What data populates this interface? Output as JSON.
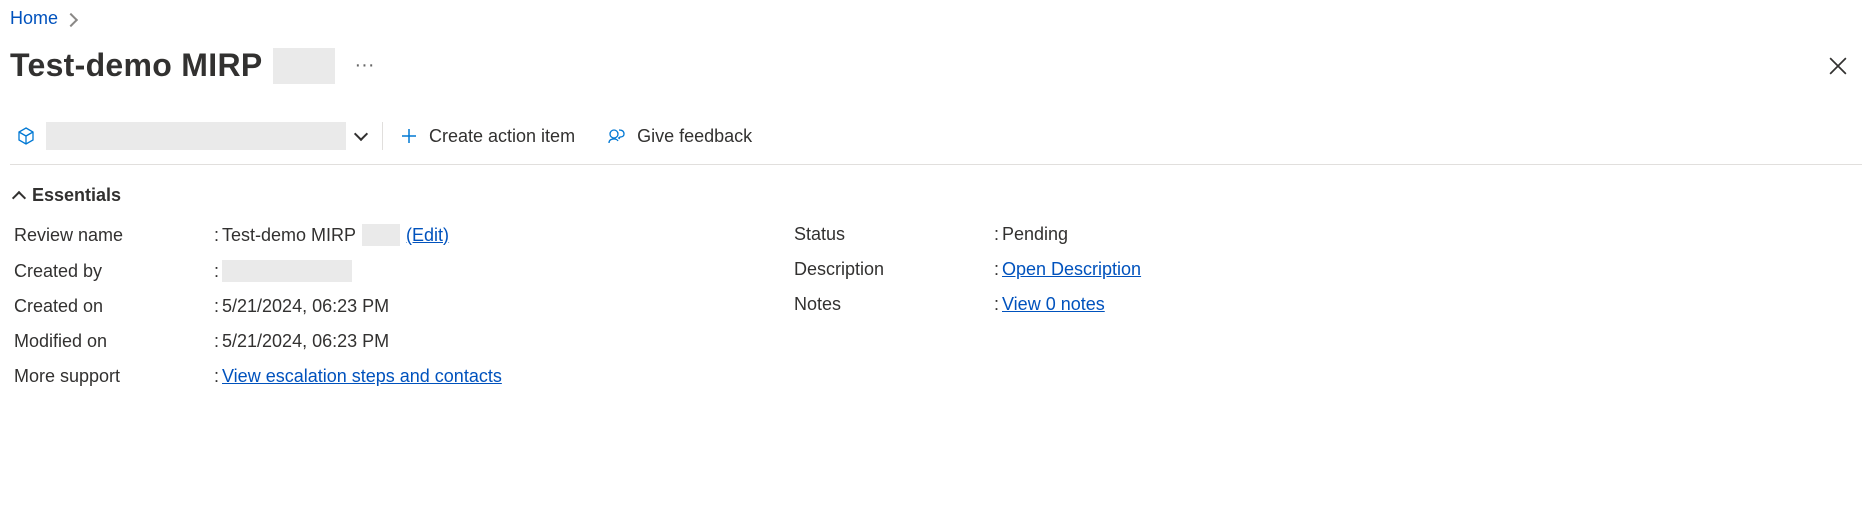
{
  "breadcrumb": {
    "home": "Home"
  },
  "title": "Test-demo MIRP",
  "toolbar": {
    "create_action_item": "Create action item",
    "give_feedback": "Give feedback"
  },
  "essentials": {
    "header": "Essentials",
    "left": {
      "review_name": {
        "label": "Review name",
        "value": "Test-demo MIRP",
        "edit_link": "(Edit)"
      },
      "created_by": {
        "label": "Created by"
      },
      "created_on": {
        "label": "Created on",
        "value": "5/21/2024, 06:23 PM"
      },
      "modified_on": {
        "label": "Modified on",
        "value": "5/21/2024, 06:23 PM"
      },
      "more_support": {
        "label": "More support",
        "link": "View escalation steps and contacts"
      }
    },
    "right": {
      "status": {
        "label": "Status",
        "value": "Pending"
      },
      "description": {
        "label": "Description",
        "link": "Open Description"
      },
      "notes": {
        "label": "Notes",
        "link": "View 0 notes"
      }
    }
  }
}
